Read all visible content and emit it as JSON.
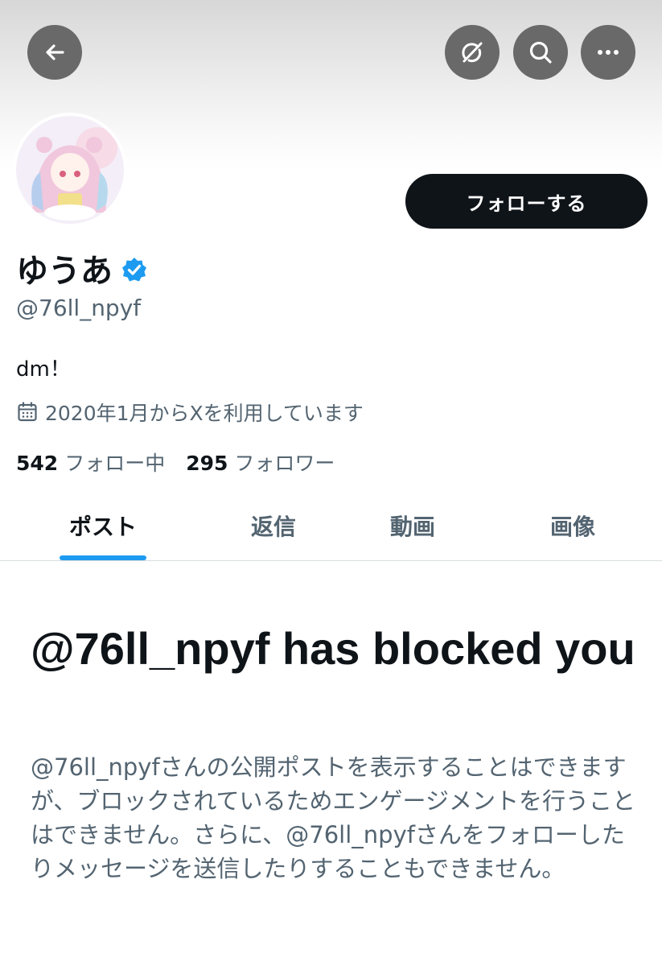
{
  "header": {
    "back_icon": "arrow-left-icon",
    "grok_icon": "slash-circle-icon",
    "search_icon": "search-icon",
    "more_icon": "ellipsis-icon"
  },
  "profile": {
    "display_name": "ゆうあ",
    "handle": "@76ll_npyf",
    "bio": "dm！",
    "joined": "2020年1月からXを利用しています",
    "following_count": "542",
    "following_label": "フォロー中",
    "followers_count": "295",
    "followers_label": "フォロワー",
    "follow_button_label": "フォローする"
  },
  "tabs": [
    {
      "label": "ポスト",
      "active": true
    },
    {
      "label": "返信",
      "active": false
    },
    {
      "label": "動画",
      "active": false
    },
    {
      "label": "画像",
      "active": false
    }
  ],
  "blocked": {
    "title": "@76ll_npyf has blocked you",
    "description": "@76ll_npyfさんの公開ポストを表示することはできますが、ブロックされているためエンゲージメントを行うことはできません。さらに、@76ll_npyfさんをフォローしたりメッセージを送信したりすることもできません。"
  },
  "colors": {
    "accent": "#1d9bf0",
    "text_primary": "#0f1419",
    "text_secondary": "#536471",
    "header_button": "#696969"
  }
}
